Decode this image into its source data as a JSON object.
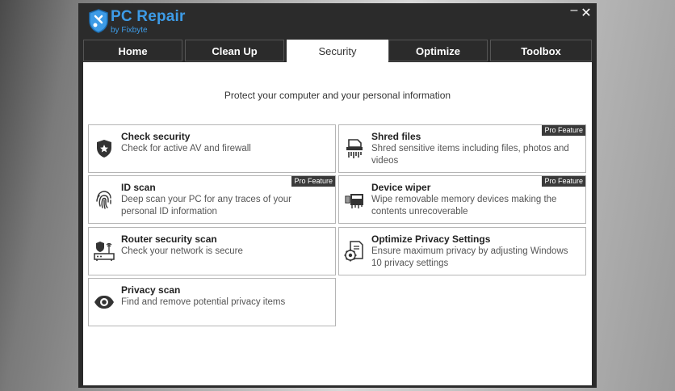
{
  "app": {
    "title": "PC Repair",
    "subtitle": "by Fixbyte",
    "minimize_glyph": "–",
    "close_glyph": "✕"
  },
  "tabs": [
    {
      "label": "Home",
      "active": false
    },
    {
      "label": "Clean Up",
      "active": false
    },
    {
      "label": "Security",
      "active": true
    },
    {
      "label": "Optimize",
      "active": false
    },
    {
      "label": "Toolbox",
      "active": false
    }
  ],
  "main": {
    "subtitle": "Protect your computer and your personal information",
    "pro_badge": "Pro Feature",
    "cards": [
      {
        "title": "Check security",
        "desc": "Check for active AV and firewall",
        "icon": "shield-star-icon",
        "pro": false
      },
      {
        "title": "Shred files",
        "desc": "Shred sensitive items including files, photos and videos",
        "icon": "shredder-icon",
        "pro": true
      },
      {
        "title": "ID scan",
        "desc": "Deep scan your PC for any traces of your personal ID information",
        "icon": "fingerprint-icon",
        "pro": true
      },
      {
        "title": "Device wiper",
        "desc": "Wipe removable memory devices making the contents unrecoverable",
        "icon": "device-wiper-icon",
        "pro": true
      },
      {
        "title": "Router security scan",
        "desc": "Check your network is secure",
        "icon": "router-shield-icon",
        "pro": false
      },
      {
        "title": "Optimize Privacy Settings",
        "desc": "Ensure maximum privacy by adjusting Windows 10 privacy settings",
        "icon": "document-gear-icon",
        "pro": false
      },
      {
        "title": "Privacy scan",
        "desc": "Find and remove potential privacy items",
        "icon": "eye-icon",
        "pro": false
      }
    ]
  },
  "colors": {
    "brand": "#3d9be6",
    "window_frame": "#2b2b2b",
    "badge_bg": "#3a3a3a"
  }
}
